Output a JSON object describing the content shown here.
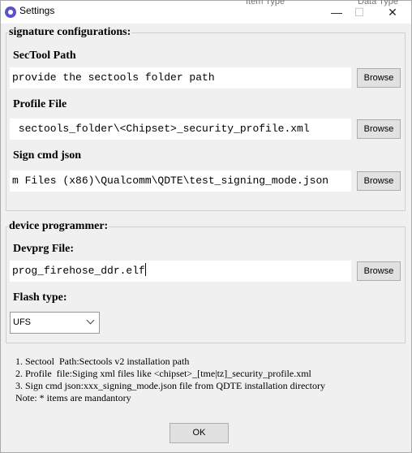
{
  "window": {
    "title": "Settings",
    "controls": {
      "minimize": "—",
      "maximize": "☐",
      "close": "✕"
    },
    "background_labels": [
      "Item Type",
      "Data Type"
    ]
  },
  "signature": {
    "legend": "signature configurations:",
    "sectool_label": "SecTool Path",
    "sectool_value": "provide the sectools folder path",
    "profile_label": "Profile File",
    "profile_value": " sectools_folder\\<Chipset>_security_profile.xml",
    "signcmd_label": "Sign cmd json",
    "signcmd_value": "m Files (x86)\\Qualcomm\\QDTE\\test_signing_mode.json",
    "browse_label": "Browse"
  },
  "device": {
    "legend": "device programmer:",
    "devprg_label": "Devprg File:",
    "devprg_value": "prog_firehose_ddr.elf",
    "browse_label": "Browse",
    "flash_label": "Flash type:",
    "flash_value": "UFS"
  },
  "notes": [
    "1. Sectool  Path:Sectools v2 installation path",
    "2. Profile  file:Siging xml files like <chipset>_[tme|tz]_security_profile.xml",
    "3. Sign cmd json:xxx_signing_mode.json file from QDTE installation directory",
    "Note: * items are mandantory"
  ],
  "ok_label": "OK",
  "colors": {
    "window_bg": "#f0f0f0",
    "titlebar_bg": "#ffffff",
    "input_bg": "#ffffff",
    "button_bg": "#e1e1e1",
    "icon": "#5a52c8"
  }
}
